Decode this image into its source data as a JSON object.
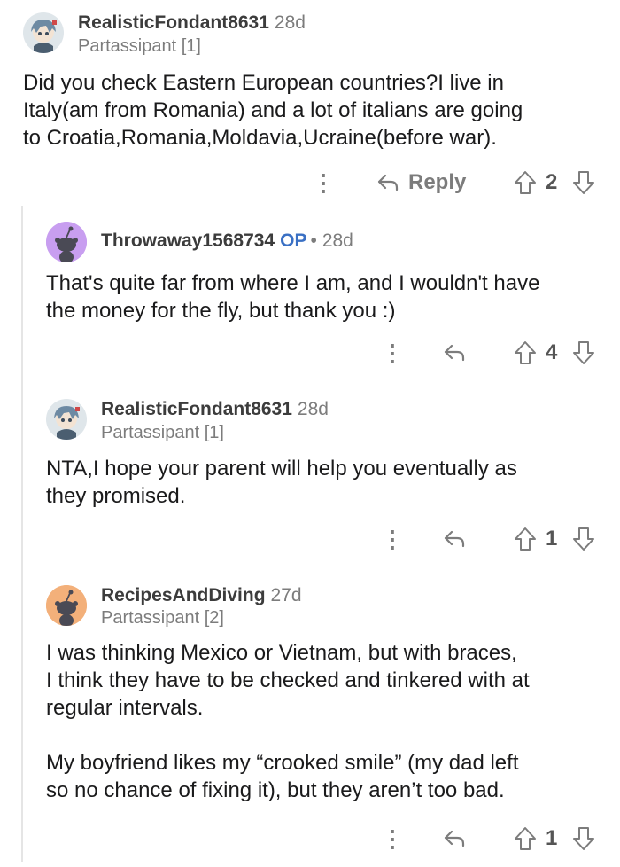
{
  "comments": [
    {
      "username": "RealisticFondant8631",
      "time": "28d",
      "flair": "Partassipant [1]",
      "lines": [
        "Did you check Eastern European countries?I live in",
        "Italy(am from Romania) and a lot of italians are going",
        "to Croatia,Romania,Moldavia,Ucraine(before war)."
      ],
      "reply_label": "Reply",
      "votes": "2"
    },
    {
      "username": "Throwaway1568734",
      "op_badge": "OP",
      "separator": "•",
      "time": "28d",
      "lines": [
        "That's quite far from where I am, and I wouldn't have",
        "the money for the fly, but thank you :)"
      ],
      "votes": "4"
    },
    {
      "username": "RealisticFondant8631",
      "time": "28d",
      "flair": "Partassipant [1]",
      "lines": [
        "NTA,I hope your parent will help you eventually as",
        "they promised."
      ],
      "votes": "1"
    },
    {
      "username": "RecipesAndDiving",
      "time": "27d",
      "flair": "Partassipant [2]",
      "lines": [
        "I was thinking Mexico or Vietnam, but with braces,",
        "I think they have to be checked and tinkered with at",
        "regular intervals.",
        "",
        "My boyfriend likes my “crooked smile” (my dad left",
        "so no chance of fixing it), but they aren’t too bad."
      ],
      "votes": "1"
    }
  ],
  "icons": {
    "overflow": "more-options-icon",
    "reply": "reply-arrow-icon",
    "upvote": "upvote-arrow-icon",
    "downvote": "downvote-arrow-icon"
  },
  "colors": {
    "op": "#3a70c4",
    "avatar_purple": "#c89ef0",
    "avatar_orange": "#f3b07a",
    "meta": "#7c7c7c"
  }
}
